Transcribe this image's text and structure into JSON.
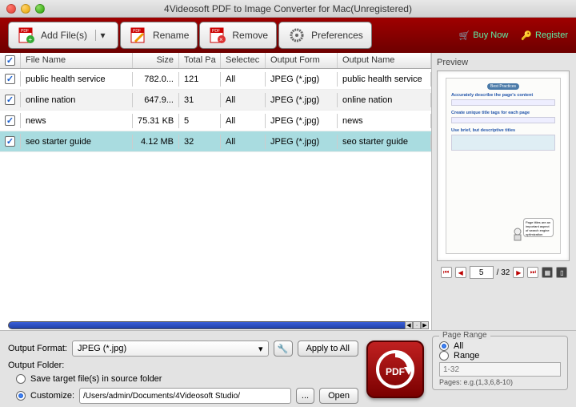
{
  "window": {
    "title": "4Videosoft PDF to Image Converter for Mac(Unregistered)"
  },
  "toolbar": {
    "add_files": "Add File(s)",
    "rename": "Rename",
    "remove": "Remove",
    "preferences": "Preferences",
    "buy_now": "Buy Now",
    "register": "Register"
  },
  "columns": {
    "filename": "File Name",
    "size": "Size",
    "total": "Total Pa",
    "selected": "Selectec",
    "format": "Output Form",
    "outname": "Output Name"
  },
  "rows": [
    {
      "name": "public health service",
      "size": "782.0...",
      "total": "121",
      "sel": "All",
      "fmt": "JPEG (*.jpg)",
      "out": "public health service"
    },
    {
      "name": "online nation",
      "size": "647.9...",
      "total": "31",
      "sel": "All",
      "fmt": "JPEG (*.jpg)",
      "out": "online nation"
    },
    {
      "name": "news",
      "size": "75.31 KB",
      "total": "5",
      "sel": "All",
      "fmt": "JPEG (*.jpg)",
      "out": "news"
    },
    {
      "name": "seo starter guide",
      "size": "4.12 MB",
      "total": "32",
      "sel": "All",
      "fmt": "JPEG (*.jpg)",
      "out": "seo starter guide"
    }
  ],
  "preview": {
    "label": "Preview",
    "page_current": "5",
    "page_total": "/ 32",
    "doc": {
      "badge": "Best Practices",
      "h1": "Accurately describe the page's content",
      "h2": "Create unique title tags for each page",
      "h3": "Use brief, but descriptive titles"
    }
  },
  "footer": {
    "output_format_label": "Output Format:",
    "output_format_value": "JPEG (*.jpg)",
    "apply_all": "Apply to All",
    "output_folder_label": "Output Folder:",
    "save_source": "Save target file(s) in source folder",
    "customize": "Customize:",
    "path": "/Users/admin/Documents/4Videosoft Studio/",
    "open": "Open",
    "more": "..."
  },
  "page_range": {
    "legend": "Page Range",
    "all": "All",
    "range": "Range",
    "placeholder": "1-32",
    "hint": "Pages: e.g.(1,3,6,8-10)"
  }
}
